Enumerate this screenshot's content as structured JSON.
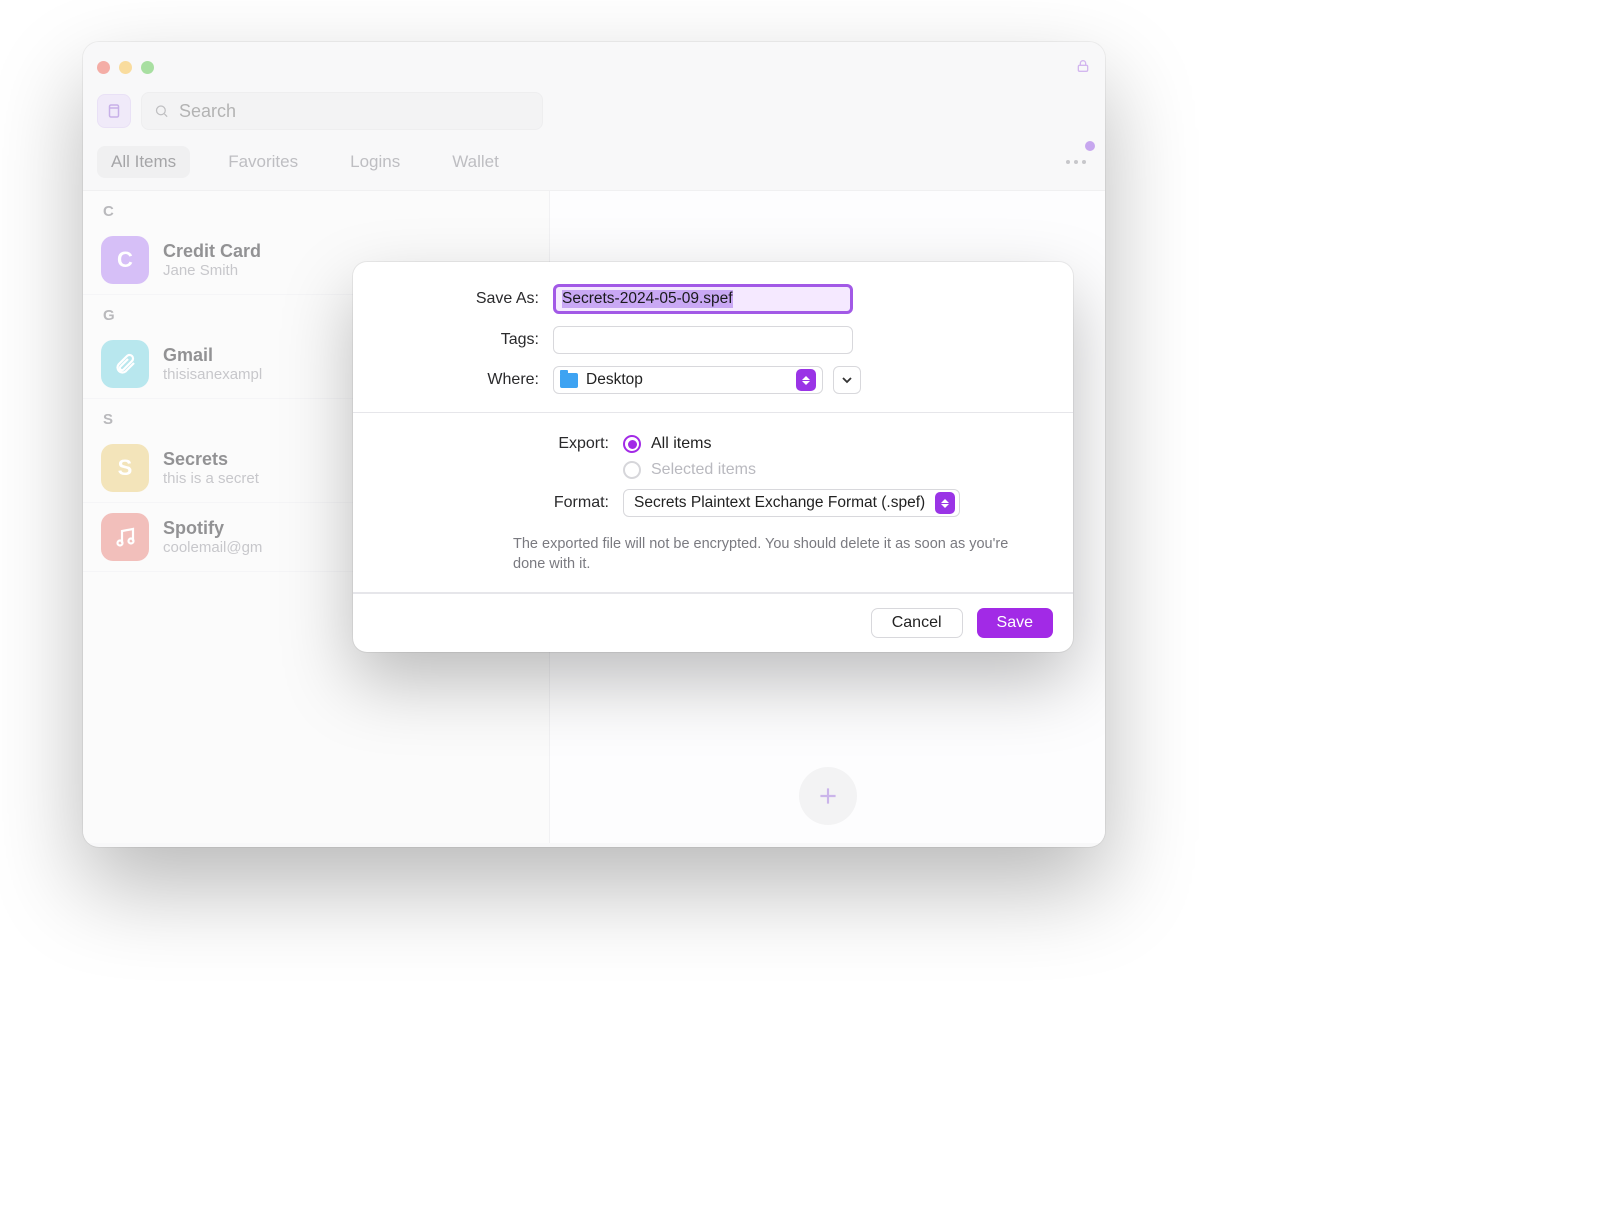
{
  "toolbar": {
    "search_placeholder": "Search"
  },
  "filters": {
    "all_items": "All Items",
    "favorites": "Favorites",
    "logins": "Logins",
    "wallet": "Wallet"
  },
  "sections": {
    "c": "C",
    "g": "G",
    "s": "S"
  },
  "items": {
    "credit_card": {
      "title": "Credit Card",
      "sub": "Jane Smith",
      "initial": "C"
    },
    "gmail": {
      "title": "Gmail",
      "sub": "thisisanexampl"
    },
    "secrets": {
      "title": "Secrets",
      "sub": "this is a secret",
      "initial": "S"
    },
    "spotify": {
      "title": "Spotify",
      "sub": "coolemail@gm"
    }
  },
  "modal": {
    "save_as_label": "Save As:",
    "save_as_value": "Secrets-2024-05-09.spef",
    "tags_label": "Tags:",
    "tags_value": "",
    "where_label": "Where:",
    "where_value": "Desktop",
    "export_label": "Export:",
    "export_all": "All items",
    "export_selected": "Selected items",
    "format_label": "Format:",
    "format_value": "Secrets Plaintext Exchange Format (.spef)",
    "warning": "The exported file will not be encrypted. You should delete it as soon as you're done with it.",
    "cancel": "Cancel",
    "save": "Save"
  }
}
